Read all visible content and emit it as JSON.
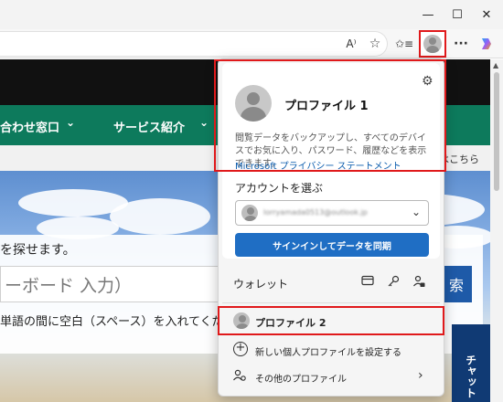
{
  "window": {
    "minimize_glyph": "—",
    "maximize_glyph": "☐",
    "close_glyph": "✕"
  },
  "toolbar": {
    "read_aloud_glyph": "A⁾",
    "favorite_glyph": "☆",
    "favorites_glyph": "✩≡",
    "more_glyph": "···"
  },
  "page": {
    "nav_items": [
      "合わせ窓口",
      "サービス紹介"
    ],
    "strip_right_text": "はこちら",
    "search_title": "を探せます。",
    "search_placeholder": "ーボード 入力）",
    "search_button_glyph": "索",
    "hint_text": "単語の間に空白（スペース）を入れてくださ",
    "chat_label": "チャット"
  },
  "flyout": {
    "profile_name": "プロファイル 1",
    "sync_description": "閲覧データをバックアップし、すべてのデバイスでお気に入り、パスワード、履歴などを表示できます。",
    "privacy_link": "Microsoft プライバシー ステートメント",
    "choose_account_label": "アカウントを選ぶ",
    "account_email": "lorryamada0513@outlook.jp",
    "signin_button": "サインインしてデータを同期",
    "wallet_label": "ウォレット",
    "profile2_label": "プロファイル 2",
    "new_profile_label": "新しい個人プロファイルを設定する",
    "other_profiles_label": "その他のプロファイル"
  },
  "colors": {
    "highlight_border": "#e0191b",
    "nav_green": "#0d7a5c",
    "signin_blue": "#1f6ec4",
    "chat_navy": "#103a74"
  }
}
